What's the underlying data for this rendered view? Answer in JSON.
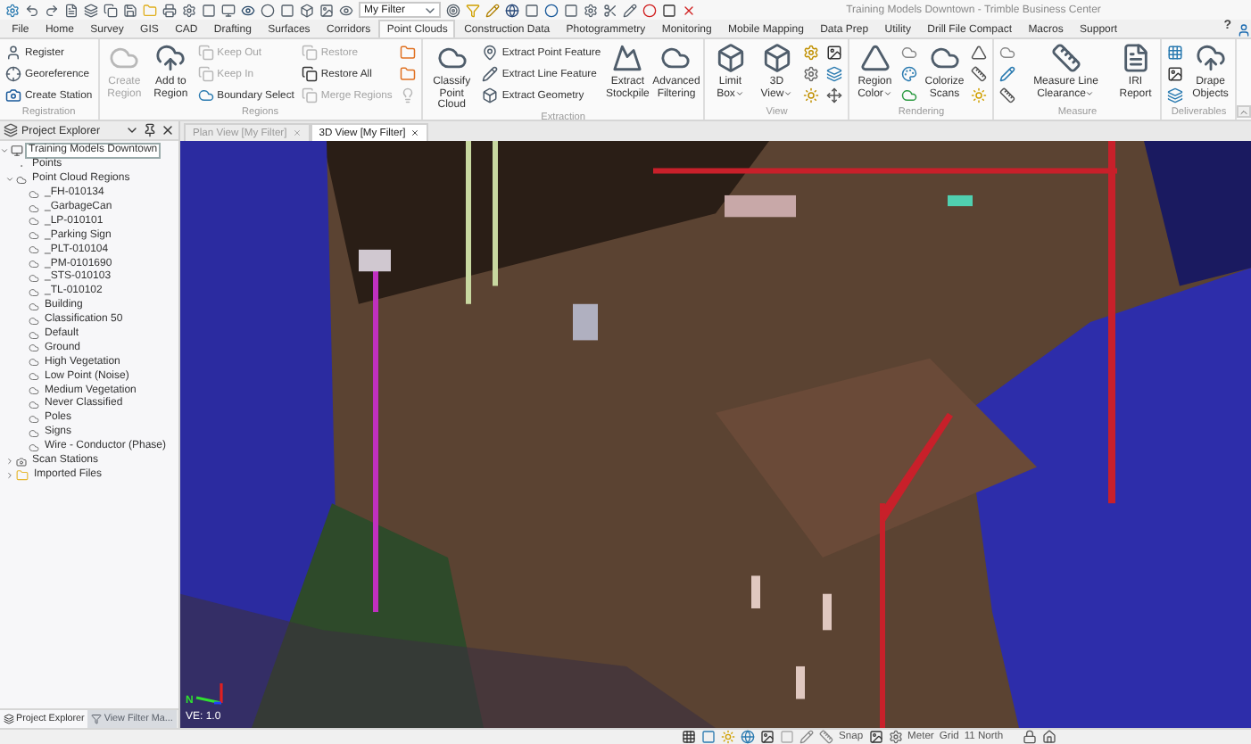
{
  "window": {
    "title": "Training Models Downtown - Trimble Business Center"
  },
  "quick_access": {
    "filter": "My Filter"
  },
  "tabs": [
    {
      "label": "File",
      "selected": false
    },
    {
      "label": "Home",
      "selected": false
    },
    {
      "label": "Survey",
      "selected": false
    },
    {
      "label": "GIS",
      "selected": false
    },
    {
      "label": "CAD",
      "selected": false
    },
    {
      "label": "Drafting",
      "selected": false
    },
    {
      "label": "Surfaces",
      "selected": false
    },
    {
      "label": "Corridors",
      "selected": false
    },
    {
      "label": "Point Clouds",
      "selected": true
    },
    {
      "label": "Construction Data",
      "selected": false
    },
    {
      "label": "Photogrammetry",
      "selected": false
    },
    {
      "label": "Monitoring",
      "selected": false
    },
    {
      "label": "Mobile Mapping",
      "selected": false
    },
    {
      "label": "Data Prep",
      "selected": false
    },
    {
      "label": "Utility",
      "selected": false
    },
    {
      "label": "Drill File Compact",
      "selected": false
    },
    {
      "label": "Macros",
      "selected": false
    },
    {
      "label": "Support",
      "selected": false
    }
  ],
  "help": "?",
  "ribbon": {
    "groups": [
      {
        "label": "Registration",
        "items": [
          {
            "kind": "small",
            "label": "Register",
            "disabled": false
          },
          {
            "kind": "small",
            "label": "Georeference",
            "disabled": false
          },
          {
            "kind": "small",
            "label": "Create Station",
            "disabled": false
          }
        ]
      },
      {
        "label": "Regions",
        "items": [
          {
            "kind": "large",
            "label": "Create Region",
            "disabled": true
          },
          {
            "kind": "large",
            "label": "Add to Region",
            "disabled": false
          },
          {
            "kind": "small",
            "label": "Keep Out",
            "disabled": true
          },
          {
            "kind": "small",
            "label": "Keep In",
            "disabled": true
          },
          {
            "kind": "small",
            "label": "Boundary Select",
            "disabled": false
          },
          {
            "kind": "small",
            "label": "Restore",
            "disabled": true
          },
          {
            "kind": "small",
            "label": "Restore All",
            "disabled": false
          },
          {
            "kind": "small",
            "label": "Merge Regions",
            "disabled": true
          },
          {
            "kind": "icon",
            "disabled": false
          },
          {
            "kind": "icon",
            "disabled": false
          },
          {
            "kind": "icon",
            "disabled": true
          }
        ]
      },
      {
        "label": "Extraction",
        "items": [
          {
            "kind": "large",
            "label": "Classify Point Cloud",
            "disabled": false
          },
          {
            "kind": "small",
            "label": "Extract Point Feature",
            "disabled": false
          },
          {
            "kind": "small",
            "label": "Extract Line Feature",
            "disabled": false
          },
          {
            "kind": "small",
            "label": "Extract Geometry",
            "disabled": false
          },
          {
            "kind": "large",
            "label": "Extract Stockpile",
            "disabled": false
          },
          {
            "kind": "large",
            "label": "Advanced Filtering",
            "disabled": false
          }
        ]
      },
      {
        "label": "View",
        "items": [
          {
            "kind": "large",
            "label": "Limit Box",
            "dropdown": true,
            "disabled": false
          },
          {
            "kind": "large",
            "label": "3D View",
            "dropdown": true,
            "disabled": false
          },
          {
            "kind": "icon",
            "disabled": false
          },
          {
            "kind": "icon",
            "disabled": false
          },
          {
            "kind": "icon",
            "disabled": false
          },
          {
            "kind": "icon",
            "disabled": false
          },
          {
            "kind": "icon",
            "disabled": false
          },
          {
            "kind": "icon",
            "disabled": false
          }
        ]
      },
      {
        "label": "Rendering",
        "items": [
          {
            "kind": "large",
            "label": "Region Color",
            "dropdown": true,
            "disabled": false
          },
          {
            "kind": "icon",
            "disabled": false
          },
          {
            "kind": "icon",
            "disabled": false
          },
          {
            "kind": "icon",
            "disabled": false
          },
          {
            "kind": "large",
            "label": "Colorize Scans",
            "disabled": false
          },
          {
            "kind": "icon",
            "disabled": false
          },
          {
            "kind": "icon",
            "disabled": false
          },
          {
            "kind": "icon",
            "disabled": false
          }
        ]
      },
      {
        "label": "Measure",
        "items": [
          {
            "kind": "icon",
            "disabled": false
          },
          {
            "kind": "icon",
            "disabled": false
          },
          {
            "kind": "icon",
            "disabled": false
          },
          {
            "kind": "large",
            "label": "Measure Line Clearance",
            "dropdown": true,
            "disabled": false
          },
          {
            "kind": "large",
            "label": "IRI Report",
            "disabled": false
          }
        ]
      },
      {
        "label": "Deliverables",
        "items": [
          {
            "kind": "icon",
            "disabled": false
          },
          {
            "kind": "icon",
            "disabled": false
          },
          {
            "kind": "icon",
            "disabled": false
          },
          {
            "kind": "large",
            "label": "Drape Objects",
            "disabled": false
          }
        ]
      }
    ]
  },
  "explorer": {
    "title": "Project Explorer",
    "tree": [
      {
        "label": "Training Models Downtown",
        "kind": "project",
        "selected": true,
        "expanded": true,
        "children": [
          {
            "label": "Points",
            "kind": "points",
            "selected": false
          },
          {
            "label": "Point Cloud Regions",
            "kind": "regions",
            "selected": false,
            "expanded": true,
            "children": [
              {
                "label": "_FH-010134",
                "kind": "region",
                "selected": false
              },
              {
                "label": "_GarbageCan",
                "kind": "region",
                "selected": false
              },
              {
                "label": "_LP-010101",
                "kind": "region",
                "selected": false
              },
              {
                "label": "_Parking Sign",
                "kind": "region",
                "selected": false
              },
              {
                "label": "_PLT-010104",
                "kind": "region",
                "selected": false
              },
              {
                "label": "_PM-0101690",
                "kind": "region",
                "selected": false
              },
              {
                "label": "_STS-010103",
                "kind": "region",
                "selected": false
              },
              {
                "label": "_TL-010102",
                "kind": "region",
                "selected": false
              },
              {
                "label": "Building",
                "kind": "region",
                "selected": false
              },
              {
                "label": "Classification 50",
                "kind": "region",
                "selected": false
              },
              {
                "label": "Default",
                "kind": "region",
                "selected": false
              },
              {
                "label": "Ground",
                "kind": "region",
                "selected": false
              },
              {
                "label": "High Vegetation",
                "kind": "region",
                "selected": false
              },
              {
                "label": "Low Point (Noise)",
                "kind": "region",
                "selected": false
              },
              {
                "label": "Medium Vegetation",
                "kind": "region",
                "selected": false
              },
              {
                "label": "Never Classified",
                "kind": "region",
                "selected": false
              },
              {
                "label": "Poles",
                "kind": "region",
                "selected": false
              },
              {
                "label": "Signs",
                "kind": "region",
                "selected": false
              },
              {
                "label": "Wire - Conductor (Phase)",
                "kind": "region",
                "selected": false
              }
            ]
          },
          {
            "label": "Scan Stations",
            "kind": "stations",
            "selected": false,
            "expanded": false
          },
          {
            "label": "Imported Files",
            "kind": "folder",
            "selected": false,
            "expanded": false
          }
        ]
      }
    ],
    "bottom_tabs": [
      {
        "label": "Project Explorer",
        "selected": true
      },
      {
        "label": "View Filter Ma...",
        "selected": false
      }
    ]
  },
  "doc_tabs": [
    {
      "label": "Plan View [My Filter]",
      "selected": false
    },
    {
      "label": "3D View [My Filter]",
      "selected": true
    }
  ],
  "viewport": {
    "axis_label": "N",
    "scale_label": "VE: 1.0"
  },
  "status_bar": {
    "snap": "Snap",
    "units": "Meter",
    "grid": "Grid",
    "zone": "11 North"
  }
}
